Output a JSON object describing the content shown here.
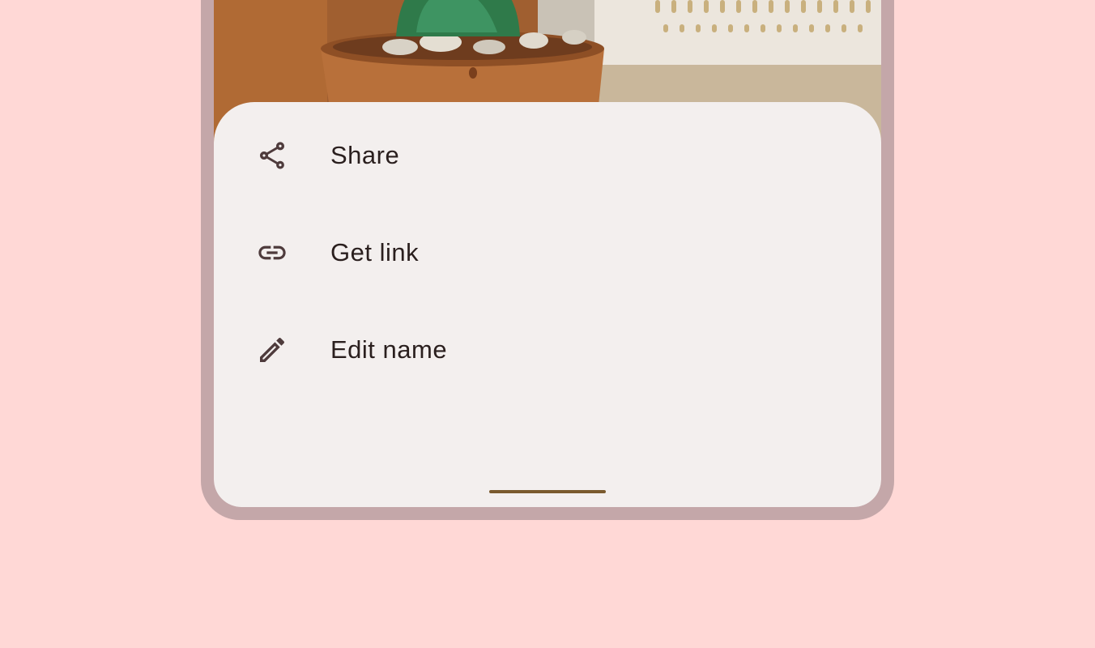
{
  "colors": {
    "background": "#FFD8D6",
    "device_frame": "#C4A7A9",
    "sheet": "#F3EFEE",
    "text": "#2A1F1E",
    "icon": "#4E3B3C",
    "handle": "#7A5A2E"
  },
  "menu": {
    "items": [
      {
        "label": "Share",
        "icon": "share-icon"
      },
      {
        "label": "Get link",
        "icon": "link-icon"
      },
      {
        "label": "Edit name",
        "icon": "edit-pencil-icon"
      }
    ]
  }
}
